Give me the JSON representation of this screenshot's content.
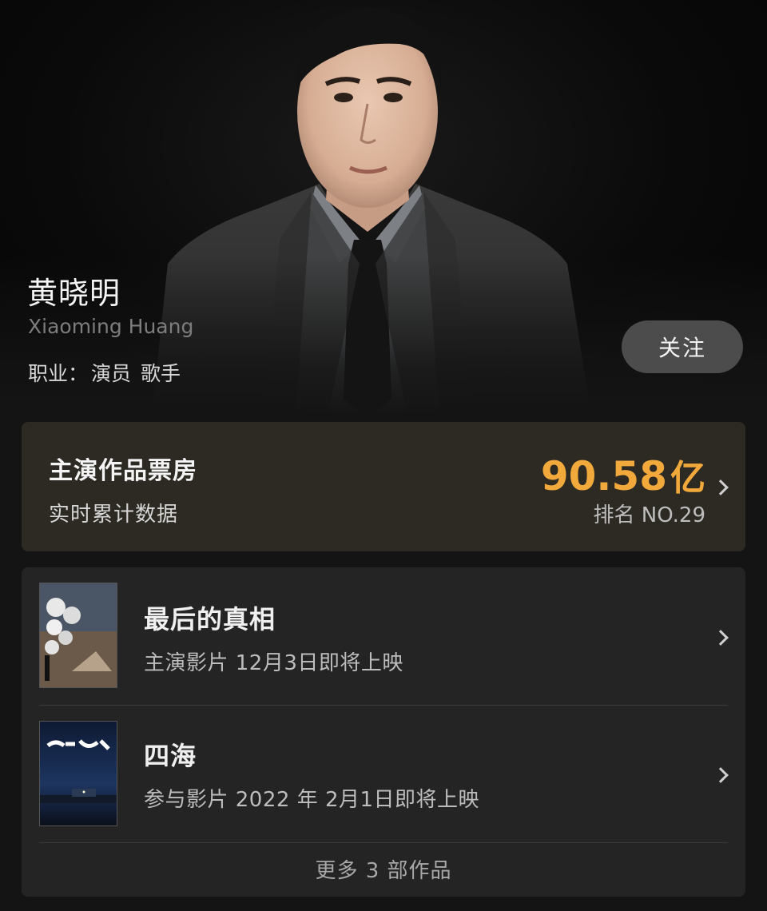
{
  "actor": {
    "name": "黄晓明",
    "latin_name": "Xiaoming Huang",
    "profession_label": "职业：",
    "professions": [
      "演员",
      "歌手"
    ],
    "follow_label": "关注"
  },
  "box_office": {
    "title": "主演作品票房",
    "subtitle": "实时累计数据",
    "value": "90.58",
    "unit": "亿",
    "rank": "排名 NO.29",
    "value_color": "#f2a93b"
  },
  "works": {
    "items": [
      {
        "title": "最后的真相",
        "description": "主演影片 12月3日即将上映",
        "poster_icon": "movie-poster-icon"
      },
      {
        "title": "四海",
        "description": "参与影片 2022 年 2月1日即将上映",
        "poster_icon": "movie-poster-icon"
      }
    ],
    "more_label": "更多 3 部作品"
  },
  "colors": {
    "background": "#141414",
    "card_box_office": "#2d2a24",
    "card_works": "#242424",
    "accent": "#f2a93b"
  }
}
